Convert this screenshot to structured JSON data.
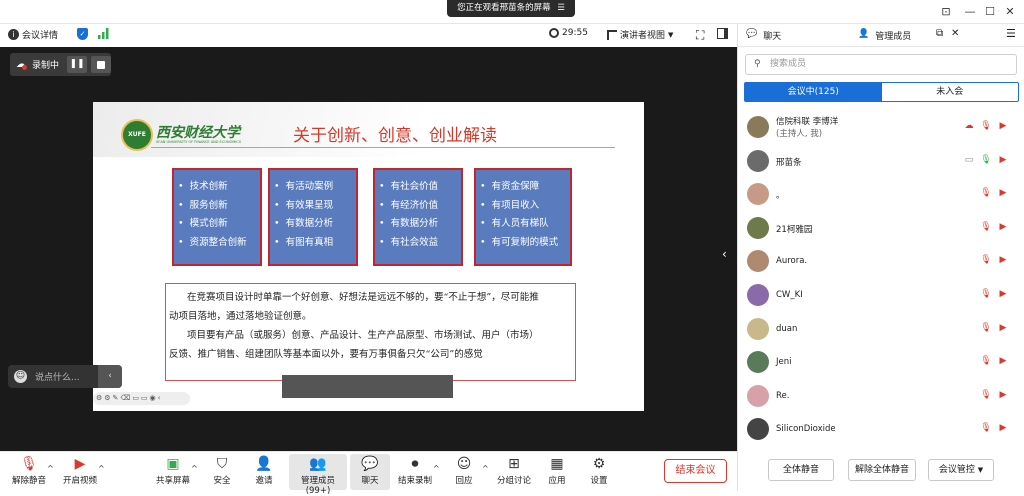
{
  "title_bar": {
    "watching": "您正在观看邢苗条的屏幕"
  },
  "top_toolbar": {
    "meeting_details": "会议详情",
    "timer": "29:55",
    "view_mode": "演讲者视图"
  },
  "recording": {
    "label": "录制中"
  },
  "slide": {
    "logo_text": "西安财经大学",
    "logo_sub": "XI'AN UNIVERSITY OF FINANCE AND ECONOMICS",
    "logo_badge": "XUFE",
    "title": "关于创新、创意、创业解读",
    "boxes": [
      {
        "items": [
          "技术创新",
          "服务创新",
          "模式创新",
          "资源整合创新"
        ]
      },
      {
        "items": [
          "有活动案例",
          "有效果呈现",
          "有数据分析",
          "有图有真相"
        ]
      },
      {
        "items": [
          "有社会价值",
          "有经济价值",
          "有数据分析",
          "有社会效益"
        ]
      },
      {
        "items": [
          "有资金保障",
          "有项目收入",
          "有人员有梯队",
          "有可复制的模式"
        ]
      }
    ],
    "paragraph_lines": [
      "在竞赛项目设计时单靠一个好创意、好想法是远远不够的，要“不止于想”，尽可能推",
      "动项目落地，通过落地验证创意。",
      "项目要有产品（或服务）创意、产品设计、生产产品原型、市场测试、用户（市场）",
      "反馈、推广销售、组建团队等基本面以外，要有万事俱备只欠“公司”的感觉"
    ]
  },
  "chat_input": {
    "placeholder": "说点什么..."
  },
  "bottom_toolbar": {
    "unmute": "解除静音",
    "start_video": "开启视频",
    "share_screen": "共享屏幕",
    "security": "安全",
    "invite": "邀请",
    "manage_members": "管理成员(99+)",
    "chat": "聊天",
    "end_recording": "结束录制",
    "reaction": "回应",
    "breakout": "分组讨论",
    "apps": "应用",
    "settings": "设置",
    "end_meeting": "结束会议"
  },
  "panel": {
    "tab_chat": "聊天",
    "tab_members": "管理成员",
    "search_placeholder": "搜索成员",
    "in_meeting": "会议中(125)",
    "not_joined": "未入会",
    "members": [
      {
        "name": "信院科联 李博洋",
        "sub": "(主持人, 我)",
        "color": "#8a7a5a"
      },
      {
        "name": "邢苗条",
        "sub": "",
        "color": "#6b6b6b"
      },
      {
        "name": "。",
        "sub": "",
        "color": "#c79a86"
      },
      {
        "name": "21柯雅园",
        "sub": "",
        "color": "#6e7a4a"
      },
      {
        "name": "Aurora.",
        "sub": "",
        "color": "#b08a70"
      },
      {
        "name": "CW_KI",
        "sub": "",
        "color": "#8a6aa8"
      },
      {
        "name": "duan",
        "sub": "",
        "color": "#c9b88a"
      },
      {
        "name": "Jeni",
        "sub": "",
        "color": "#5a7a5a"
      },
      {
        "name": "Re.",
        "sub": "",
        "color": "#d8a0a8"
      },
      {
        "name": "SiliconDioxide",
        "sub": "",
        "color": "#444444"
      }
    ],
    "mute_all": "全体静音",
    "unmute_all": "解除全体静音",
    "meeting_control": "会议管控"
  },
  "colors": {
    "accent": "#1a6ed8",
    "danger": "#e0352b",
    "box_fill": "#5a7cbf",
    "box_border": "#c0262d"
  }
}
